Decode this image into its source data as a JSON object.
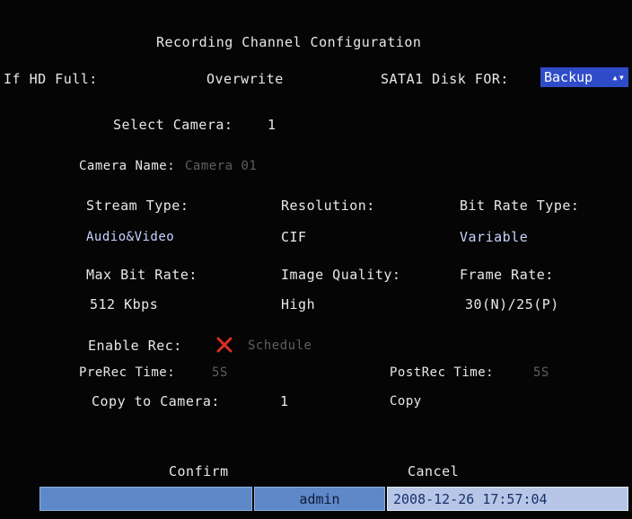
{
  "title": "Recording Channel Configuration",
  "hd_full": {
    "label": "If HD Full:",
    "value": "Overwrite"
  },
  "sata_disk": {
    "label": "SATA1 Disk FOR:",
    "value": "Backup",
    "arrow_glyph": "▴▾"
  },
  "select_camera": {
    "label": "Select Camera:",
    "value": "1"
  },
  "camera_name": {
    "label": "Camera Name:",
    "value": "Camera 01"
  },
  "stream_type": {
    "label": "Stream Type:",
    "value": "Audio&Video"
  },
  "resolution": {
    "label": "Resolution:",
    "value": "CIF"
  },
  "bit_rate_type": {
    "label": "Bit Rate Type:",
    "value": "Variable"
  },
  "max_bit_rate": {
    "label": "Max Bit Rate:",
    "value": "512 Kbps"
  },
  "image_quality": {
    "label": "Image Quality:",
    "value": "High"
  },
  "frame_rate": {
    "label": "Frame Rate:",
    "value": "30(N)/25(P)"
  },
  "enable_rec": {
    "label": "Enable Rec:",
    "checked": false,
    "schedule_label": "Schedule"
  },
  "prerec": {
    "label": "PreRec Time:",
    "value": "5S"
  },
  "postrec": {
    "label": "PostRec Time:",
    "value": "5S"
  },
  "copy_to_camera": {
    "label": "Copy to Camera:",
    "value": "1",
    "button": "Copy"
  },
  "actions": {
    "confirm": "Confirm",
    "cancel": "Cancel"
  },
  "status_bar": {
    "user": "admin",
    "datetime": "2008-12-26 17:57:04"
  },
  "colors": {
    "background": "#050505",
    "selection": "#2f4cc8",
    "status_bar": "#5f88c8",
    "status_time": "#b7c6e6",
    "unchecked_cross": "#d83020"
  }
}
